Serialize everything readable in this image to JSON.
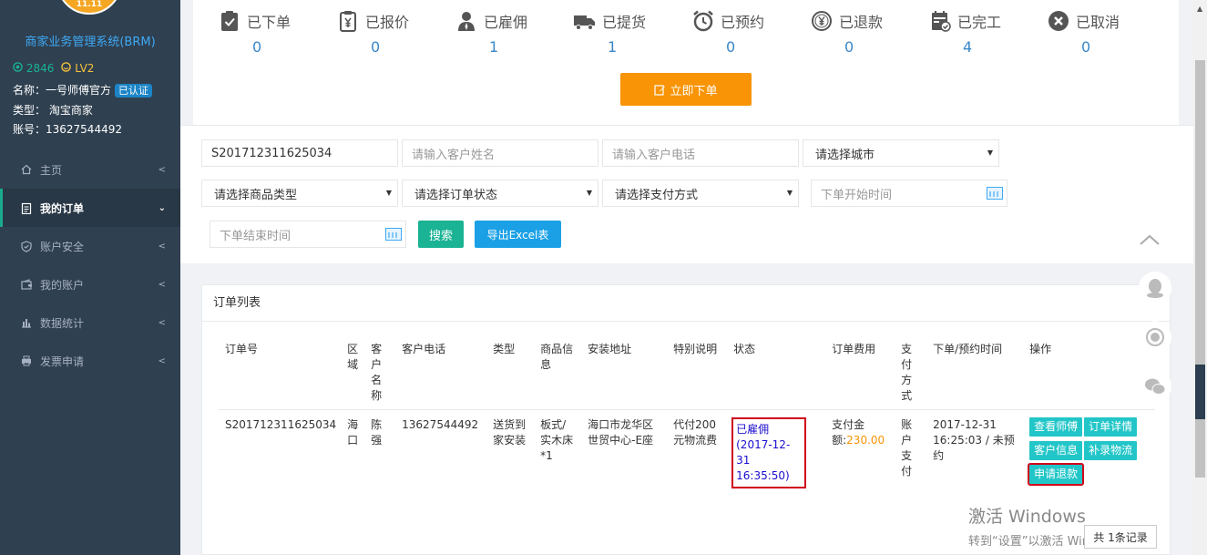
{
  "sidebar": {
    "logo_badge": "11.11",
    "system_title": "商家业务管理系统(BRM)",
    "points": "2846",
    "level": "LV2",
    "name_label": "名称：一号师傅官方",
    "verified": "已认证",
    "type_label": "类型：  淘宝商家",
    "account_label": "账号：13627544492",
    "items": [
      {
        "label": "主页",
        "icon": "home-icon"
      },
      {
        "label": "我的订单",
        "icon": "clipboard-icon",
        "active": true
      },
      {
        "label": "账户安全",
        "icon": "shield-icon"
      },
      {
        "label": "我的账户",
        "icon": "wallet-icon"
      },
      {
        "label": "数据统计",
        "icon": "bar-chart-icon"
      },
      {
        "label": "发票申请",
        "icon": "printer-icon"
      }
    ]
  },
  "stats": [
    {
      "label": "已下单",
      "value": "0"
    },
    {
      "label": "已报价",
      "value": "0"
    },
    {
      "label": "已雇佣",
      "value": "1"
    },
    {
      "label": "已提货",
      "value": "1"
    },
    {
      "label": "已预约",
      "value": "0"
    },
    {
      "label": "已退款",
      "value": "0"
    },
    {
      "label": "已完工",
      "value": "4"
    },
    {
      "label": "已取消",
      "value": "0"
    }
  ],
  "order_button": "立即下单",
  "filters": {
    "order_no": "S201712311625034",
    "customer_name_placeholder": "请输入客户姓名",
    "customer_phone_placeholder": "请输入客户电话",
    "city": "请选择城市",
    "goods_type": "请选择商品类型",
    "order_status": "请选择订单状态",
    "payment": "请选择支付方式",
    "start_time_placeholder": "下单开始时间",
    "end_time_placeholder": "下单结束时间",
    "search_button": "搜索",
    "export_button": "导出Excel表"
  },
  "order_list": {
    "title": "订单列表",
    "columns": [
      "订单号",
      "区域",
      "客户名称",
      "客户电话",
      "类型",
      "商品信息",
      "安装地址",
      "特别说明",
      "状态",
      "订单费用",
      "支付方式",
      "下单/预约时间",
      "操作"
    ],
    "row": {
      "order_no": "S201712311625034",
      "region": "海口",
      "customer": "陈强",
      "phone": "13627544492",
      "type": "送货到家安装",
      "goods": "板式/实木床*1",
      "address": "海口市龙华区世贸中心-E座",
      "note": "代付200元物流费",
      "status": "已雇佣(2017-12-31 16:35:50)",
      "fee_label": "支付金额:",
      "fee_amount": "230.00",
      "payment": "账户支付",
      "time": "2017-12-31 16:25:03 / 未预约",
      "actions": [
        "查看师傅",
        "订单详情",
        "客户信息",
        "补录物流",
        "申请退款"
      ]
    }
  },
  "pager_text": "共 1条记录",
  "watermark": {
    "line1": "激活 Windows",
    "line2": "转到“设置”以激活 Windows。"
  },
  "colors": {
    "sidebar_bg": "#2f4050",
    "accent_green": "#1ab394",
    "accent_orange": "#f89406",
    "accent_blue": "#1ba0e6",
    "action_teal": "#23c6c8",
    "highlight_red": "#d0021b"
  }
}
